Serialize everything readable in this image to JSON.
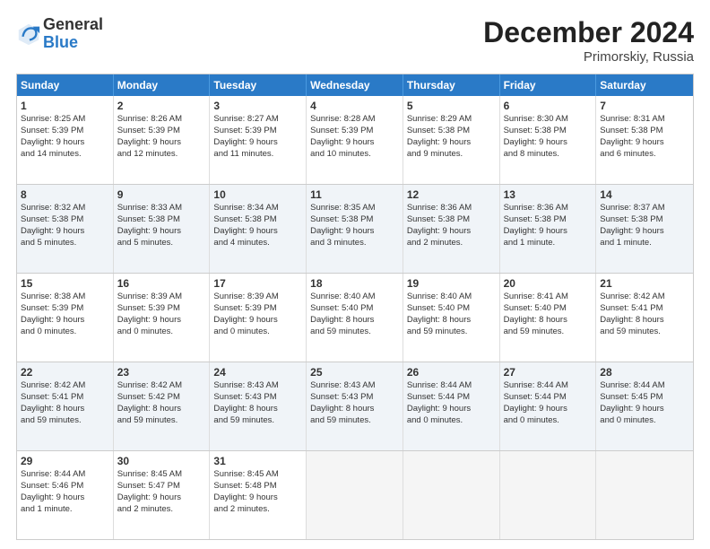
{
  "header": {
    "logo_general": "General",
    "logo_blue": "Blue",
    "month_title": "December 2024",
    "location": "Primorskiy, Russia"
  },
  "weekdays": [
    "Sunday",
    "Monday",
    "Tuesday",
    "Wednesday",
    "Thursday",
    "Friday",
    "Saturday"
  ],
  "rows": [
    [
      {
        "day": "1",
        "lines": [
          "Sunrise: 8:25 AM",
          "Sunset: 5:39 PM",
          "Daylight: 9 hours",
          "and 14 minutes."
        ]
      },
      {
        "day": "2",
        "lines": [
          "Sunrise: 8:26 AM",
          "Sunset: 5:39 PM",
          "Daylight: 9 hours",
          "and 12 minutes."
        ]
      },
      {
        "day": "3",
        "lines": [
          "Sunrise: 8:27 AM",
          "Sunset: 5:39 PM",
          "Daylight: 9 hours",
          "and 11 minutes."
        ]
      },
      {
        "day": "4",
        "lines": [
          "Sunrise: 8:28 AM",
          "Sunset: 5:39 PM",
          "Daylight: 9 hours",
          "and 10 minutes."
        ]
      },
      {
        "day": "5",
        "lines": [
          "Sunrise: 8:29 AM",
          "Sunset: 5:38 PM",
          "Daylight: 9 hours",
          "and 9 minutes."
        ]
      },
      {
        "day": "6",
        "lines": [
          "Sunrise: 8:30 AM",
          "Sunset: 5:38 PM",
          "Daylight: 9 hours",
          "and 8 minutes."
        ]
      },
      {
        "day": "7",
        "lines": [
          "Sunrise: 8:31 AM",
          "Sunset: 5:38 PM",
          "Daylight: 9 hours",
          "and 6 minutes."
        ]
      }
    ],
    [
      {
        "day": "8",
        "lines": [
          "Sunrise: 8:32 AM",
          "Sunset: 5:38 PM",
          "Daylight: 9 hours",
          "and 5 minutes."
        ]
      },
      {
        "day": "9",
        "lines": [
          "Sunrise: 8:33 AM",
          "Sunset: 5:38 PM",
          "Daylight: 9 hours",
          "and 5 minutes."
        ]
      },
      {
        "day": "10",
        "lines": [
          "Sunrise: 8:34 AM",
          "Sunset: 5:38 PM",
          "Daylight: 9 hours",
          "and 4 minutes."
        ]
      },
      {
        "day": "11",
        "lines": [
          "Sunrise: 8:35 AM",
          "Sunset: 5:38 PM",
          "Daylight: 9 hours",
          "and 3 minutes."
        ]
      },
      {
        "day": "12",
        "lines": [
          "Sunrise: 8:36 AM",
          "Sunset: 5:38 PM",
          "Daylight: 9 hours",
          "and 2 minutes."
        ]
      },
      {
        "day": "13",
        "lines": [
          "Sunrise: 8:36 AM",
          "Sunset: 5:38 PM",
          "Daylight: 9 hours",
          "and 1 minute."
        ]
      },
      {
        "day": "14",
        "lines": [
          "Sunrise: 8:37 AM",
          "Sunset: 5:38 PM",
          "Daylight: 9 hours",
          "and 1 minute."
        ]
      }
    ],
    [
      {
        "day": "15",
        "lines": [
          "Sunrise: 8:38 AM",
          "Sunset: 5:39 PM",
          "Daylight: 9 hours",
          "and 0 minutes."
        ]
      },
      {
        "day": "16",
        "lines": [
          "Sunrise: 8:39 AM",
          "Sunset: 5:39 PM",
          "Daylight: 9 hours",
          "and 0 minutes."
        ]
      },
      {
        "day": "17",
        "lines": [
          "Sunrise: 8:39 AM",
          "Sunset: 5:39 PM",
          "Daylight: 9 hours",
          "and 0 minutes."
        ]
      },
      {
        "day": "18",
        "lines": [
          "Sunrise: 8:40 AM",
          "Sunset: 5:40 PM",
          "Daylight: 8 hours",
          "and 59 minutes."
        ]
      },
      {
        "day": "19",
        "lines": [
          "Sunrise: 8:40 AM",
          "Sunset: 5:40 PM",
          "Daylight: 8 hours",
          "and 59 minutes."
        ]
      },
      {
        "day": "20",
        "lines": [
          "Sunrise: 8:41 AM",
          "Sunset: 5:40 PM",
          "Daylight: 8 hours",
          "and 59 minutes."
        ]
      },
      {
        "day": "21",
        "lines": [
          "Sunrise: 8:42 AM",
          "Sunset: 5:41 PM",
          "Daylight: 8 hours",
          "and 59 minutes."
        ]
      }
    ],
    [
      {
        "day": "22",
        "lines": [
          "Sunrise: 8:42 AM",
          "Sunset: 5:41 PM",
          "Daylight: 8 hours",
          "and 59 minutes."
        ]
      },
      {
        "day": "23",
        "lines": [
          "Sunrise: 8:42 AM",
          "Sunset: 5:42 PM",
          "Daylight: 8 hours",
          "and 59 minutes."
        ]
      },
      {
        "day": "24",
        "lines": [
          "Sunrise: 8:43 AM",
          "Sunset: 5:43 PM",
          "Daylight: 8 hours",
          "and 59 minutes."
        ]
      },
      {
        "day": "25",
        "lines": [
          "Sunrise: 8:43 AM",
          "Sunset: 5:43 PM",
          "Daylight: 8 hours",
          "and 59 minutes."
        ]
      },
      {
        "day": "26",
        "lines": [
          "Sunrise: 8:44 AM",
          "Sunset: 5:44 PM",
          "Daylight: 9 hours",
          "and 0 minutes."
        ]
      },
      {
        "day": "27",
        "lines": [
          "Sunrise: 8:44 AM",
          "Sunset: 5:44 PM",
          "Daylight: 9 hours",
          "and 0 minutes."
        ]
      },
      {
        "day": "28",
        "lines": [
          "Sunrise: 8:44 AM",
          "Sunset: 5:45 PM",
          "Daylight: 9 hours",
          "and 0 minutes."
        ]
      }
    ],
    [
      {
        "day": "29",
        "lines": [
          "Sunrise: 8:44 AM",
          "Sunset: 5:46 PM",
          "Daylight: 9 hours",
          "and 1 minute."
        ]
      },
      {
        "day": "30",
        "lines": [
          "Sunrise: 8:45 AM",
          "Sunset: 5:47 PM",
          "Daylight: 9 hours",
          "and 2 minutes."
        ]
      },
      {
        "day": "31",
        "lines": [
          "Sunrise: 8:45 AM",
          "Sunset: 5:48 PM",
          "Daylight: 9 hours",
          "and 2 minutes."
        ]
      },
      {
        "day": "",
        "lines": []
      },
      {
        "day": "",
        "lines": []
      },
      {
        "day": "",
        "lines": []
      },
      {
        "day": "",
        "lines": []
      }
    ]
  ]
}
